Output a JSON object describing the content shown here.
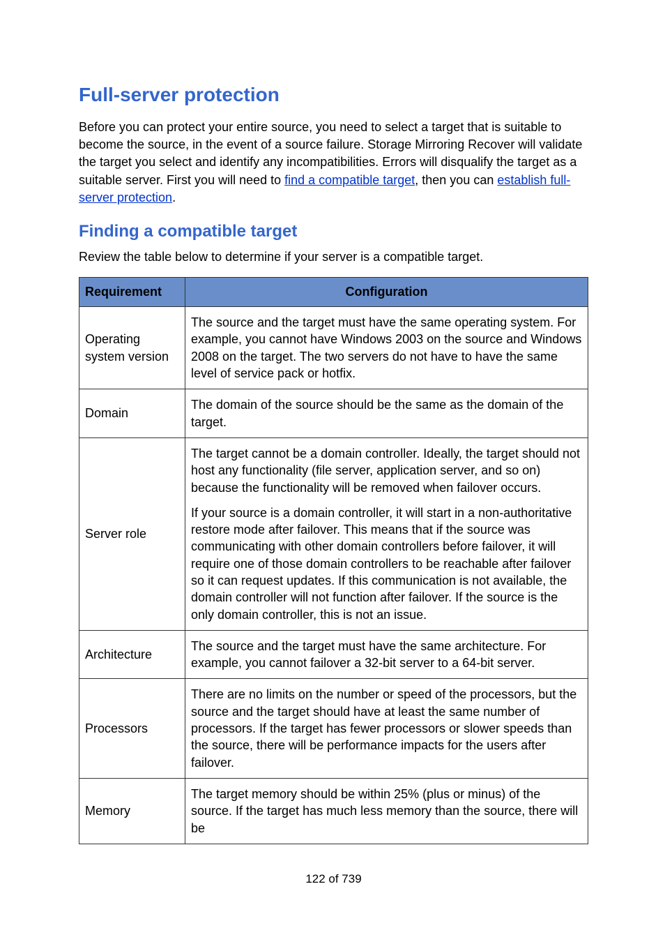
{
  "title": "Full-server protection",
  "intro": {
    "pre": "Before you can protect your entire source, you need to select a target that is suitable to become the source, in the event of a source failure. Storage Mirroring Recover will validate the target you select and identify any incompatibilities. Errors will disqualify the target as a suitable server. First you will need to ",
    "link1": "find a compatible target",
    "mid": ", then you can ",
    "link2": "establish full-server protection",
    "post": "."
  },
  "section2_title": "Finding a compatible target",
  "section2_intro": "Review the table below to determine if your server is a compatible target.",
  "table": {
    "headers": [
      "Requirement",
      "Configuration"
    ],
    "rows": [
      {
        "req": "Operating system version",
        "conf": [
          "The source and the target must have the same operating system. For example, you cannot have Windows 2003 on the source and Windows 2008 on the target. The two servers do not have to have the same level of service pack or hotfix."
        ]
      },
      {
        "req": "Domain",
        "conf": [
          "The domain of the source should be the same as the domain of the target."
        ]
      },
      {
        "req": "Server role",
        "conf": [
          "The target cannot be a domain controller. Ideally, the target should not host any functionality (file server, application server, and so on) because the functionality will be removed when failover occurs.",
          "If your source is a domain controller, it will start in a non-authoritative restore mode after failover. This means that if the source was communicating with other domain controllers before failover, it will require one of those domain controllers to be reachable after failover so it can request updates. If this communication is not available, the domain controller will not function after failover. If the source is the only domain controller, this is not an issue."
        ]
      },
      {
        "req": "Architecture",
        "conf": [
          "The source and the target must have the same architecture. For example, you cannot failover a 32-bit server to a 64-bit server."
        ]
      },
      {
        "req": "Processors",
        "conf": [
          "There are no limits on the number or speed of the processors, but the source and the target should have at least the same number of processors. If the target has fewer processors or slower speeds than the source, there will be performance impacts for the users after failover."
        ]
      },
      {
        "req": "Memory",
        "conf": [
          "The target memory should be within 25% (plus or minus) of the source. If the target has much less memory than the source, there will be"
        ]
      }
    ]
  },
  "footer": "122 of 739"
}
